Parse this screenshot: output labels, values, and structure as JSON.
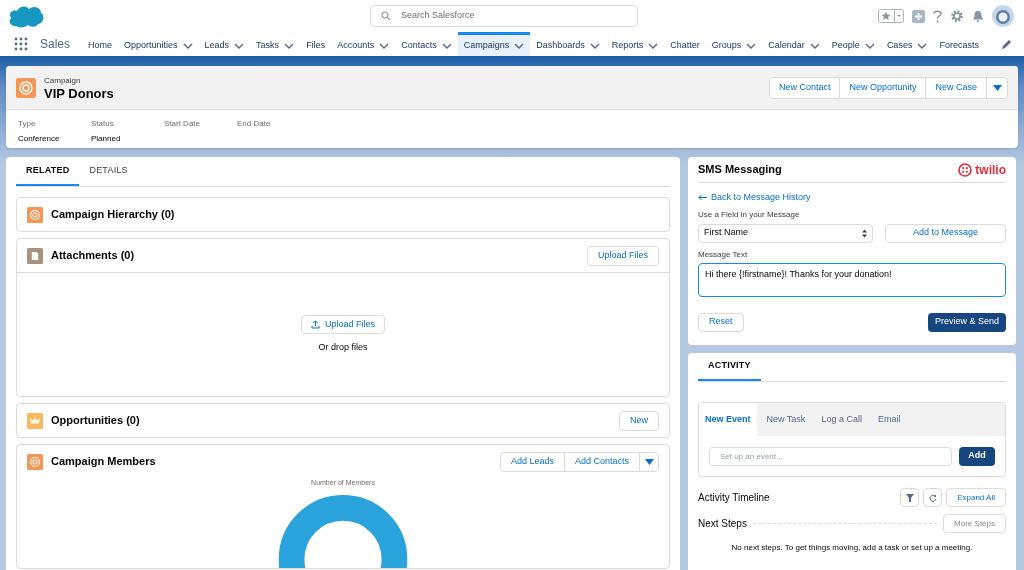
{
  "header": {
    "search": {
      "placeholder": "Search Salesforce"
    }
  },
  "nav": {
    "app_name": "Sales",
    "items": [
      {
        "label": "Home",
        "selected": false,
        "has_menu": false
      },
      {
        "label": "Opportunities",
        "selected": false,
        "has_menu": true
      },
      {
        "label": "Leads",
        "selected": false,
        "has_menu": true
      },
      {
        "label": "Tasks",
        "selected": false,
        "has_menu": true
      },
      {
        "label": "Files",
        "selected": false,
        "has_menu": false
      },
      {
        "label": "Accounts",
        "selected": false,
        "has_menu": true
      },
      {
        "label": "Contacts",
        "selected": false,
        "has_menu": true
      },
      {
        "label": "Campaigns",
        "selected": true,
        "has_menu": true
      },
      {
        "label": "Dashboards",
        "selected": false,
        "has_menu": true
      },
      {
        "label": "Reports",
        "selected": false,
        "has_menu": true
      },
      {
        "label": "Chatter",
        "selected": false,
        "has_menu": false
      },
      {
        "label": "Groups",
        "selected": false,
        "has_menu": true
      },
      {
        "label": "Calendar",
        "selected": false,
        "has_menu": true
      },
      {
        "label": "People",
        "selected": false,
        "has_menu": true
      },
      {
        "label": "Cases",
        "selected": false,
        "has_menu": true
      },
      {
        "label": "Forecasts",
        "selected": false,
        "has_menu": false
      }
    ]
  },
  "record": {
    "object": "Campaign",
    "name": "VIP Donors",
    "actions": [
      "New Contact",
      "New Opportunity",
      "New Case"
    ],
    "fields": [
      {
        "label": "Type",
        "value": "Conference"
      },
      {
        "label": "Status",
        "value": "Planned"
      },
      {
        "label": "Start Date"
      },
      {
        "label": "End Date"
      }
    ]
  },
  "main_tabs": [
    {
      "label": "RELATED",
      "selected": true
    },
    {
      "label": "DETAILS",
      "selected": false
    }
  ],
  "related": [
    {
      "kind": "hierarchy",
      "title": "Campaign Hierarchy (0)"
    },
    {
      "kind": "attachments",
      "title": "Attachments (0)",
      "button": "Upload Files",
      "upload_button": "Upload Files",
      "drop_hint": "Or drop files"
    },
    {
      "kind": "opportunities",
      "title": "Opportunities (0)",
      "button": "New"
    },
    {
      "kind": "members",
      "title": "Campaign Members",
      "buttons": [
        "Add Leads",
        "Add Contacts"
      ],
      "chart_title": "Number of Members"
    }
  ],
  "sms": {
    "title": "SMS Messaging",
    "brand": "twilio",
    "back_link": "Back to Message History",
    "field_label": "Use a Field in your Message",
    "field_value": "First Name",
    "add_button": "Add to Message",
    "message_label": "Message Text",
    "message": "Hi there {!firstname}! Thanks for your donation!",
    "reset_button": "Reset",
    "send_button": "Preview & Send"
  },
  "activity": {
    "tab": "ACTIVITY",
    "composer_tabs": [
      {
        "label": "New Event",
        "selected": true
      },
      {
        "label": "New Task",
        "selected": false
      },
      {
        "label": "Log a Call",
        "selected": false
      },
      {
        "label": "Email",
        "selected": false
      }
    ],
    "event_placeholder": "Set up an event...",
    "add_button": "Add",
    "timeline_title": "Activity Timeline",
    "expand_button": "Expand All",
    "next_steps": "Next Steps",
    "more_steps": "More Steps",
    "empty_text": "No next steps. To get things moving, add a task or set up a meeting."
  }
}
